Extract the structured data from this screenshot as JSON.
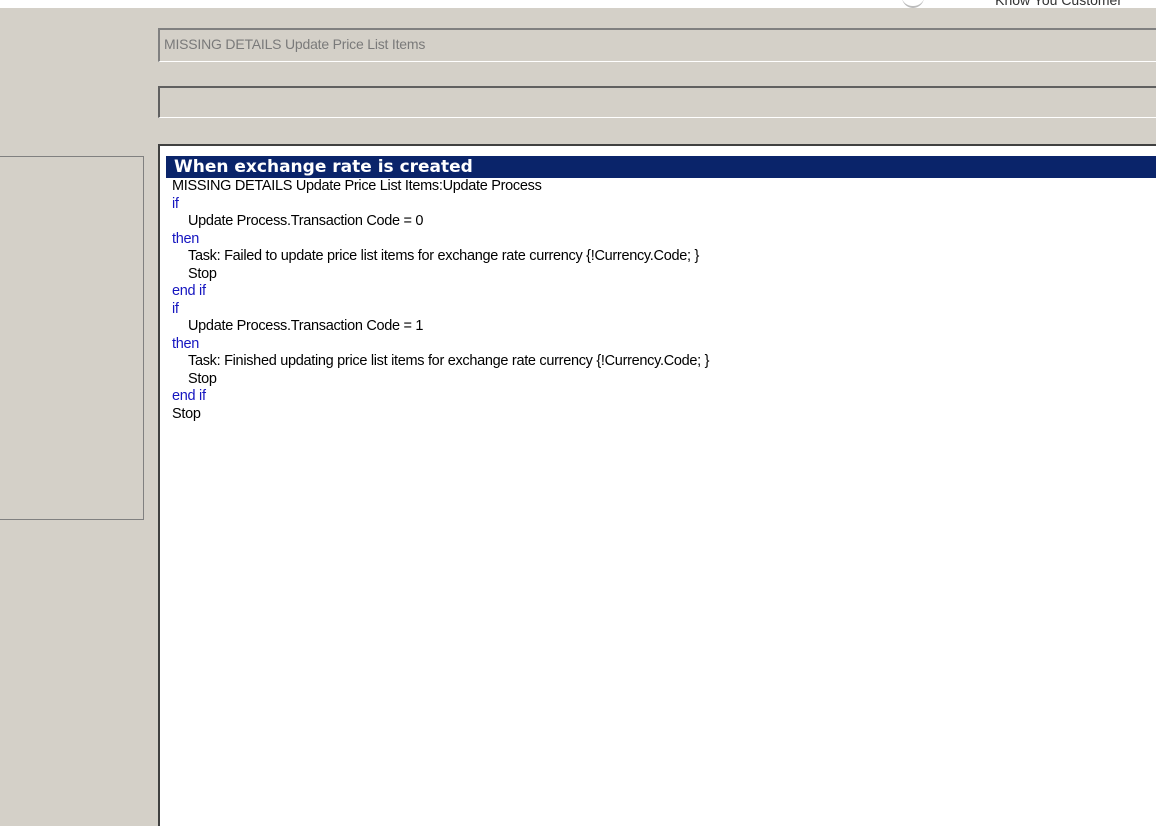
{
  "header": {
    "corner_text": "Know You Customer"
  },
  "title_field": {
    "value": "MISSING DETAILS Update Price List Items"
  },
  "secondary_field": {
    "value": ""
  },
  "editor": {
    "rule_title": "When exchange rate is created",
    "lines": [
      {
        "text": "MISSING DETAILS Update Price List Items:Update Process"
      },
      {
        "text": "if"
      },
      {
        "text": "Update Process.Transaction Code = 0"
      },
      {
        "text": "then"
      },
      {
        "text": "Task: Failed to update price list items for exchange rate currency {!Currency.Code; }"
      },
      {
        "text": "Stop"
      },
      {
        "text": "end if"
      },
      {
        "text": "if"
      },
      {
        "text": "Update Process.Transaction Code = 1"
      },
      {
        "text": "then"
      },
      {
        "text": "Task: Finished updating price list items for exchange rate currency {!Currency.Code; }"
      },
      {
        "text": "Stop"
      },
      {
        "text": "end if"
      },
      {
        "text": "Stop"
      }
    ]
  },
  "colors": {
    "header_bg": "#0a246a",
    "keyword": "#1515c0",
    "window_bg": "#d4d0c8"
  }
}
